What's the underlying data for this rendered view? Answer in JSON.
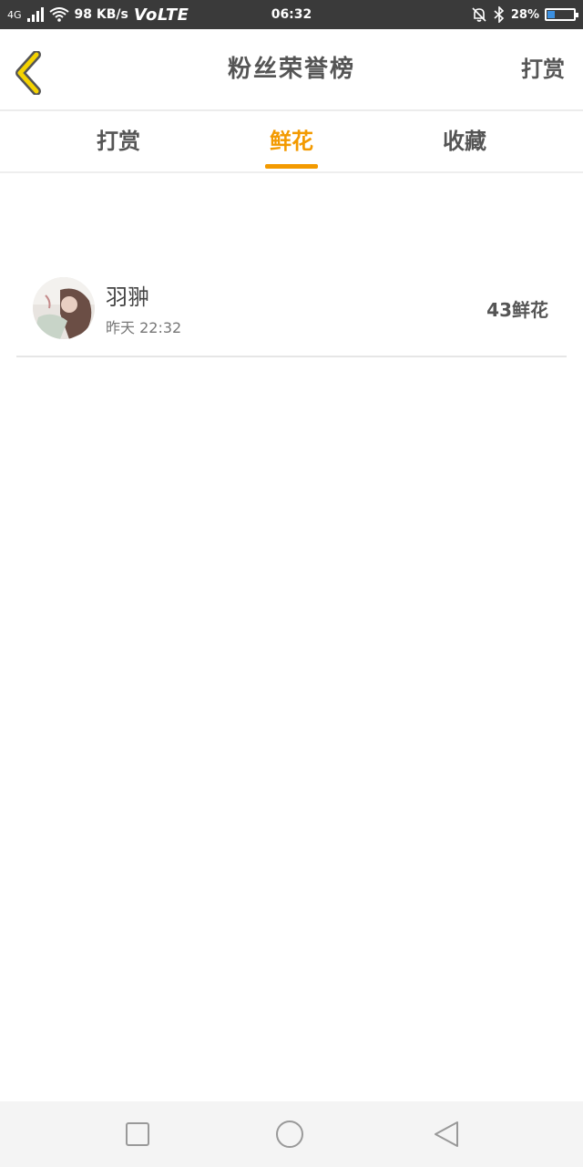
{
  "status_bar": {
    "network": "4G",
    "speed": "98 KB/s",
    "volte": "VoLTE",
    "time": "06:32",
    "battery": "28%",
    "battery_level": 0.28
  },
  "header": {
    "title": "粉丝荣誉榜",
    "action": "打赏"
  },
  "tabs": [
    {
      "label": "打赏",
      "active": false
    },
    {
      "label": "鲜花",
      "active": true
    },
    {
      "label": "收藏",
      "active": false
    }
  ],
  "list": [
    {
      "name": "羽翀",
      "time": "昨天 22:32",
      "amount": "43鲜花"
    }
  ],
  "colors": {
    "accent": "#f39a00",
    "status_bar": "#3a3a3a",
    "text": "#555555"
  },
  "icons": {
    "back": "chevron-left-icon",
    "recent": "square-icon",
    "home": "circle-icon",
    "nav_back": "triangle-back-icon"
  }
}
